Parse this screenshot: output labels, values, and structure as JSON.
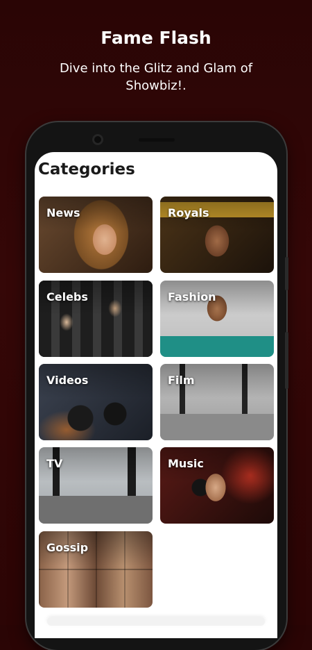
{
  "promo": {
    "title": "Fame Flash",
    "subtitle": "Dive into the Glitz and Glam of Showbiz!."
  },
  "screen": {
    "title": "Categories",
    "categories": [
      {
        "label": "News",
        "icon": "portrait-photo"
      },
      {
        "label": "Royals",
        "icon": "crowned-portrait-photo"
      },
      {
        "label": "Celebs",
        "icon": "red-carpet-photo"
      },
      {
        "label": "Fashion",
        "icon": "fashion-model-photo"
      },
      {
        "label": "Videos",
        "icon": "video-camera-photo"
      },
      {
        "label": "Film",
        "icon": "film-set-photo"
      },
      {
        "label": "TV",
        "icon": "tv-studio-photo"
      },
      {
        "label": "Music",
        "icon": "singer-microphone-photo"
      },
      {
        "label": "Gossip",
        "icon": "faces-collage-photo"
      }
    ]
  },
  "colors": {
    "background": "#300606",
    "screen": "#ffffff",
    "text_light": "#ffffff",
    "text_dark": "#1a1a1a"
  }
}
